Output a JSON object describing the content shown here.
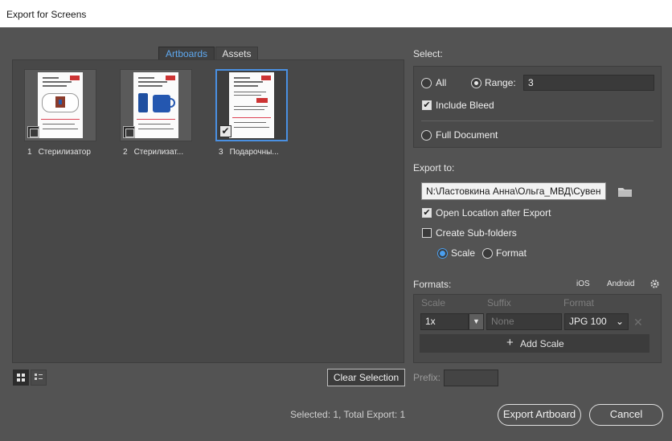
{
  "window": {
    "title": "Export for Screens"
  },
  "tabs": [
    {
      "label": "Artboards",
      "active": true
    },
    {
      "label": "Assets",
      "active": false
    }
  ],
  "artboards": [
    {
      "number": "1",
      "name": "Стерилизатор",
      "selected": false,
      "checked": false
    },
    {
      "number": "2",
      "name": "Стерилизат...",
      "selected": false,
      "checked": false
    },
    {
      "number": "3",
      "name": "Подарочны...",
      "selected": true,
      "checked": true
    }
  ],
  "view": {
    "grid_icon": "grid-view-icon",
    "list_icon": "list-view-icon"
  },
  "clear_selection_label": "Clear Selection",
  "status_text": "Selected: 1, Total Export: 1",
  "select": {
    "heading": "Select:",
    "all_label": "All",
    "range_label": "Range:",
    "range_value": "3",
    "include_bleed_label": "Include Bleed",
    "include_bleed_checked": true,
    "full_document_label": "Full Document",
    "selected_option": "range"
  },
  "export_to": {
    "heading": "Export to:",
    "path": "N:\\Ластовкина Анна\\Ольга_МВД\\Сувен",
    "folder_icon": "folder-icon",
    "open_location_label": "Open Location after Export",
    "open_location_checked": true,
    "create_subfolders_label": "Create Sub-folders",
    "create_subfolders_checked": false,
    "scale_label": "Scale",
    "format_label": "Format",
    "subfolder_mode": "scale"
  },
  "formats": {
    "heading": "Formats:",
    "ios_label": "iOS",
    "android_label": "Android",
    "gear_icon": "gear-icon",
    "col_scale": "Scale",
    "col_suffix": "Suffix",
    "col_format": "Format",
    "row": {
      "scale": "1x",
      "suffix_placeholder": "None",
      "format": "JPG 100"
    },
    "add_scale_label": "Add Scale"
  },
  "prefix_label": "Prefix:",
  "prefix_value": "",
  "buttons": {
    "export_label": "Export Artboard",
    "cancel_label": "Cancel"
  },
  "colors": {
    "accent": "#4a90e2",
    "panel": "#535353",
    "selected_tab_text": "#5fa9f0"
  }
}
